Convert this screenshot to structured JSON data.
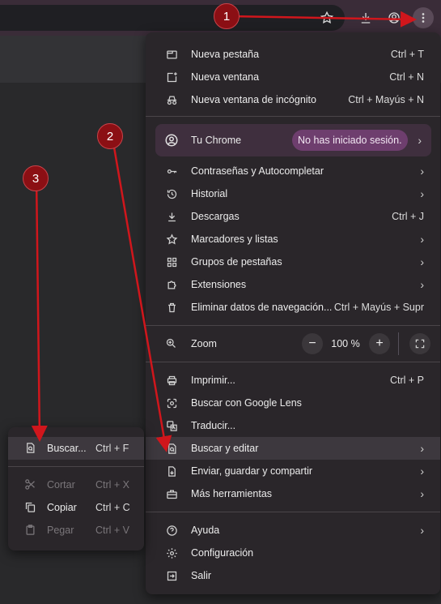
{
  "toolbar": {
    "icons": [
      "star-icon",
      "download-icon",
      "account-icon",
      "kebab-menu-icon"
    ]
  },
  "menu": {
    "group1": [
      {
        "label": "Nueva pestaña",
        "shortcut": "Ctrl + T",
        "icon": "new-tab-icon"
      },
      {
        "label": "Nueva ventana",
        "shortcut": "Ctrl + N",
        "icon": "new-window-icon"
      },
      {
        "label": "Nueva ventana de incógnito",
        "shortcut": "Ctrl + Mayús + N",
        "icon": "incognito-icon"
      }
    ],
    "profile": {
      "label": "Tu Chrome",
      "badge": "No has iniciado sesión."
    },
    "group2": [
      {
        "label": "Contraseñas y Autocompletar",
        "shortcut": "",
        "icon": "key-icon"
      },
      {
        "label": "Historial",
        "shortcut": "",
        "icon": "history-icon"
      },
      {
        "label": "Descargas",
        "shortcut": "Ctrl + J",
        "icon": "download-icon"
      },
      {
        "label": "Marcadores y listas",
        "shortcut": "",
        "icon": "star-icon"
      },
      {
        "label": "Grupos de pestañas",
        "shortcut": "",
        "icon": "tab-groups-icon"
      },
      {
        "label": "Extensiones",
        "shortcut": "",
        "icon": "puzzle-icon"
      },
      {
        "label": "Eliminar datos de navegación...",
        "shortcut": "Ctrl + Mayús + Supr",
        "icon": "trash-icon"
      }
    ],
    "zoom": {
      "label": "Zoom",
      "value": "100 %",
      "minus": "−",
      "plus": "+"
    },
    "group3": [
      {
        "label": "Imprimir...",
        "shortcut": "Ctrl + P",
        "icon": "printer-icon"
      },
      {
        "label": "Buscar con Google Lens",
        "shortcut": "",
        "icon": "lens-icon"
      },
      {
        "label": "Traducir...",
        "shortcut": "",
        "icon": "translate-icon"
      },
      {
        "label": "Buscar y editar",
        "shortcut": "",
        "icon": "find-icon"
      },
      {
        "label": "Enviar, guardar y compartir",
        "shortcut": "",
        "icon": "share-file-icon"
      },
      {
        "label": "Más herramientas",
        "shortcut": "",
        "icon": "toolbox-icon"
      }
    ],
    "group4": [
      {
        "label": "Ayuda",
        "shortcut": "",
        "icon": "help-icon"
      },
      {
        "label": "Configuración",
        "shortcut": "",
        "icon": "gear-icon"
      },
      {
        "label": "Salir",
        "shortcut": "",
        "icon": "exit-icon"
      }
    ]
  },
  "submenu": {
    "find": {
      "label": "Buscar...",
      "shortcut": "Ctrl + F"
    },
    "cut": {
      "label": "Cortar",
      "shortcut": "Ctrl + X"
    },
    "copy": {
      "label": "Copiar",
      "shortcut": "Ctrl + C"
    },
    "paste": {
      "label": "Pegar",
      "shortcut": "Ctrl + V"
    }
  },
  "annotations": {
    "step1": "1",
    "step2": "2",
    "step3": "3"
  },
  "colors": {
    "accent_red": "#d0161c",
    "badge": "#6e3e6e",
    "menu_bg": "#2a262a"
  }
}
